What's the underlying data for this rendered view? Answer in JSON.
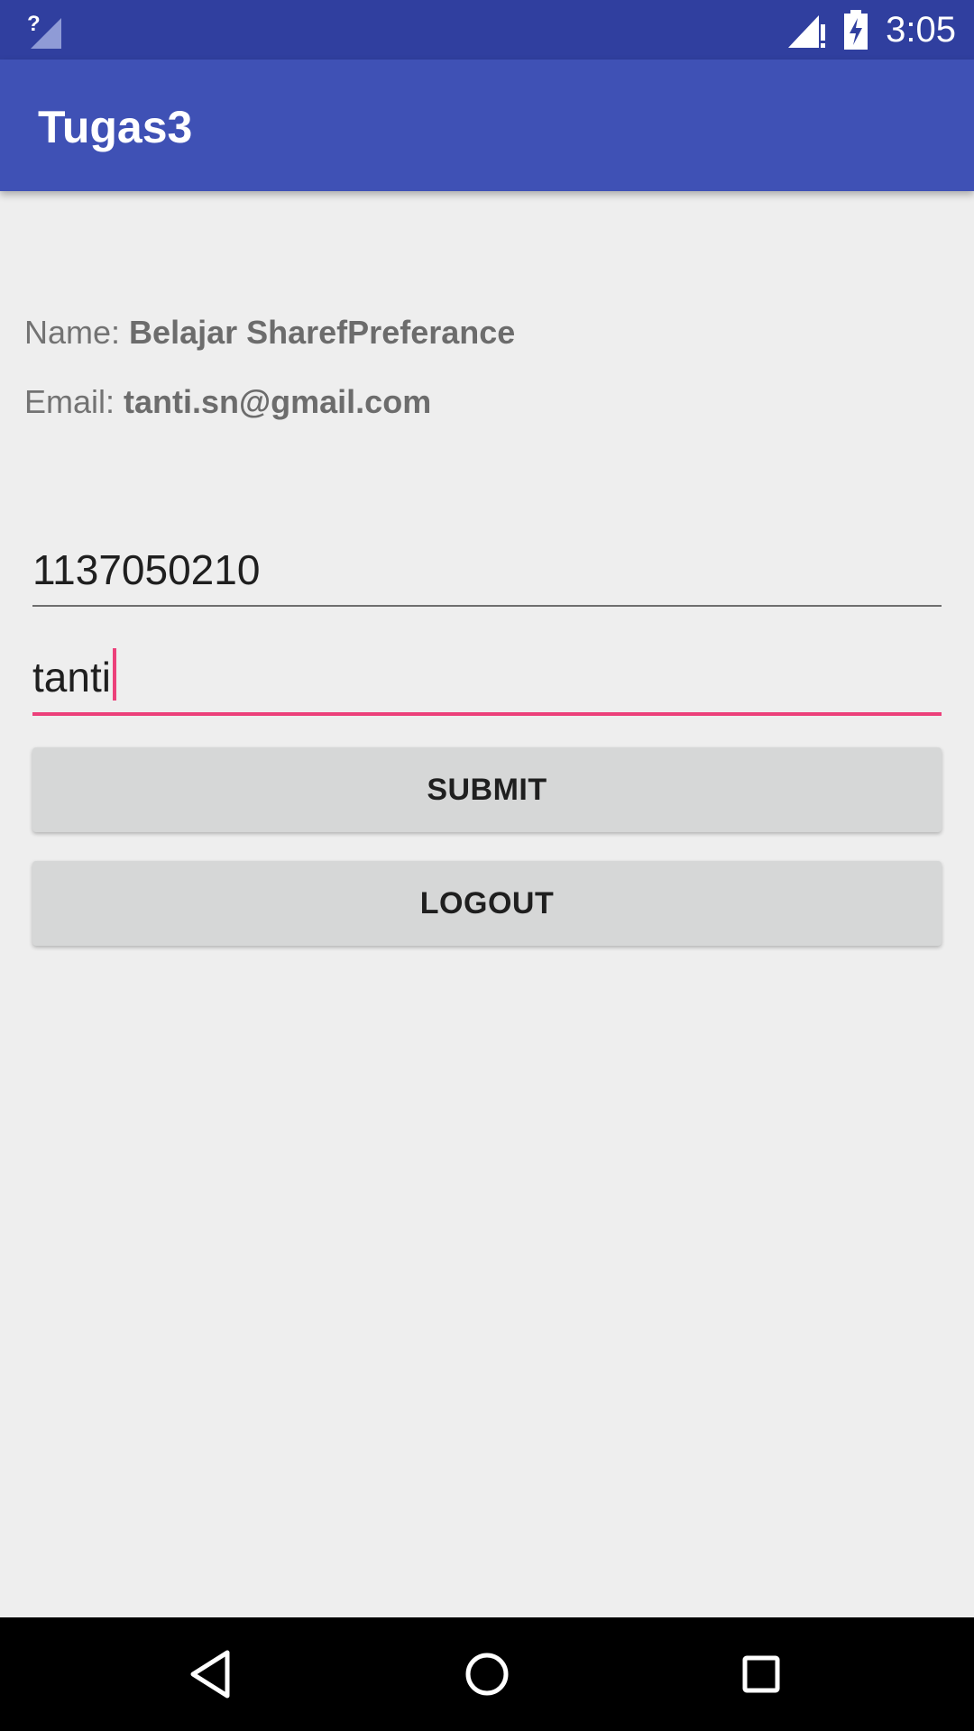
{
  "status_bar": {
    "time": "3:05",
    "left_icon": "signal-unknown-icon",
    "signal_icon": "cell-signal-alert-icon",
    "battery_icon": "battery-charging-icon",
    "color": "#303f9f"
  },
  "toolbar": {
    "title": "Tugas3",
    "color": "#3f51b5"
  },
  "profile": {
    "name_label": "Name:",
    "name_value": "Belajar SharefPreferance",
    "email_label": "Email:",
    "email_value": "tanti.sn@gmail.com"
  },
  "form": {
    "nim_value": "1137050210",
    "name_value": "tanti",
    "accent_color": "#ec407a"
  },
  "buttons": {
    "submit_label": "SUBMIT",
    "logout_label": "LOGOUT"
  },
  "nav_bar": {
    "back_icon": "back-triangle-icon",
    "home_icon": "home-circle-icon",
    "recent_icon": "recent-apps-square-icon"
  }
}
